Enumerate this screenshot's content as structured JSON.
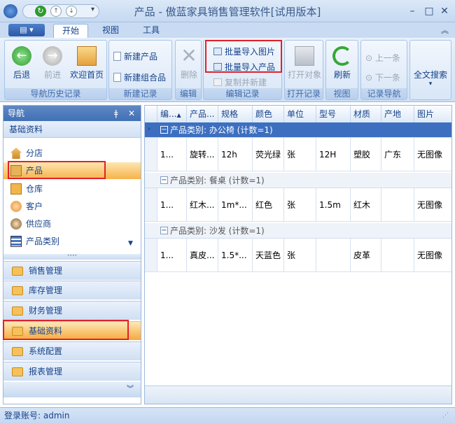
{
  "window": {
    "title": "产品 - 傲蓝家具销售管理软件[试用版本]"
  },
  "tabs": [
    {
      "label": "开始"
    },
    {
      "label": "视图"
    },
    {
      "label": "工具"
    }
  ],
  "ribbon": {
    "nav_history": {
      "label": "导航历史记录",
      "back": "后退",
      "forward": "前进",
      "home": "欢迎首页"
    },
    "new_record": {
      "label": "新建记录",
      "new_product": "新建产品",
      "new_combo": "新建组合品"
    },
    "edit": {
      "label": "编辑",
      "delete": "删除"
    },
    "edit_record": {
      "label": "编辑记录",
      "import_images": "批量导入图片",
      "import_products": "批量导入产品",
      "copy_new": "复制并新建"
    },
    "open_record": {
      "label": "打开记录",
      "open_object": "打开对象"
    },
    "view": {
      "label": "视图",
      "refresh": "刷新"
    },
    "record_nav": {
      "label": "记录导航",
      "prev": "上一条",
      "next": "下一条"
    },
    "search": {
      "label": "全文搜索"
    }
  },
  "nav": {
    "title": "导航",
    "section": "基础资料",
    "items": [
      {
        "label": "分店"
      },
      {
        "label": "产品"
      },
      {
        "label": "仓库"
      },
      {
        "label": "客户"
      },
      {
        "label": "供应商"
      },
      {
        "label": "产品类别"
      }
    ],
    "modules": [
      {
        "label": "销售管理"
      },
      {
        "label": "库存管理"
      },
      {
        "label": "财务管理"
      },
      {
        "label": "基础资料"
      },
      {
        "label": "系统配置"
      },
      {
        "label": "报表管理"
      }
    ]
  },
  "grid": {
    "columns": [
      "编...",
      "产品...",
      "规格",
      "颜色",
      "单位",
      "型号",
      "材质",
      "产地",
      "图片"
    ],
    "groups": [
      {
        "header": "产品类别: 办公椅 (计数=1)",
        "row": [
          "1...",
          "旋转...",
          "12h",
          "荧光绿",
          "张",
          "12H",
          "塑胶",
          "广东",
          "无图像"
        ]
      },
      {
        "header": "产品类别: 餐桌 (计数=1)",
        "row": [
          "1...",
          "红木...",
          "1m*...",
          "红色",
          "张",
          "1.5m",
          "红木",
          "",
          "无图像"
        ]
      },
      {
        "header": "产品类别: 沙发 (计数=1)",
        "row": [
          "1...",
          "真皮...",
          "1.5*...",
          "天蓝色",
          "张",
          "",
          "皮革",
          "",
          "无图像"
        ]
      }
    ]
  },
  "status": {
    "text": "登录账号: admin"
  },
  "colors": {
    "accent": "#3d6fc1",
    "highlight": "#f7b24b",
    "redbox": "#e0212b"
  }
}
